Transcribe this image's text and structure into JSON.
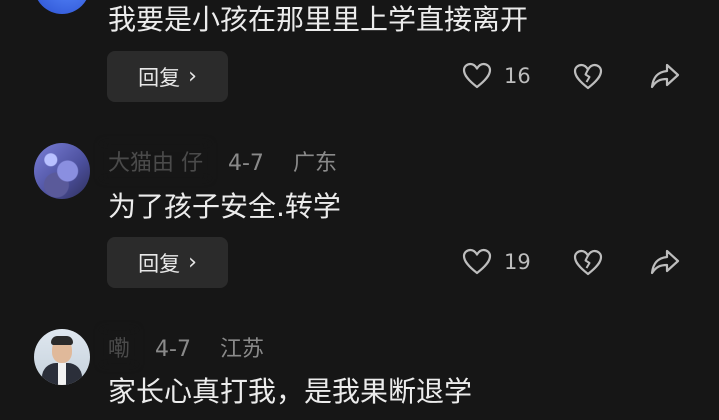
{
  "comments": [
    {
      "text": "我要是小孩在那里里上学直接离开",
      "reply_label": "回复",
      "likes": "16"
    },
    {
      "username": "大猫由 仔",
      "date": "4-7",
      "location": "广东",
      "text": "为了孩子安全.转学",
      "reply_label": "回复",
      "likes": "19"
    },
    {
      "username": "嘞 ",
      "date": "4-7",
      "location": "江苏",
      "text": "家长心真打我，是我果断退学"
    }
  ],
  "icons": {
    "reply_chevron": "›",
    "like": "heart-outline-icon",
    "dislike": "broken-heart-icon",
    "share": "share-arrow-icon"
  }
}
